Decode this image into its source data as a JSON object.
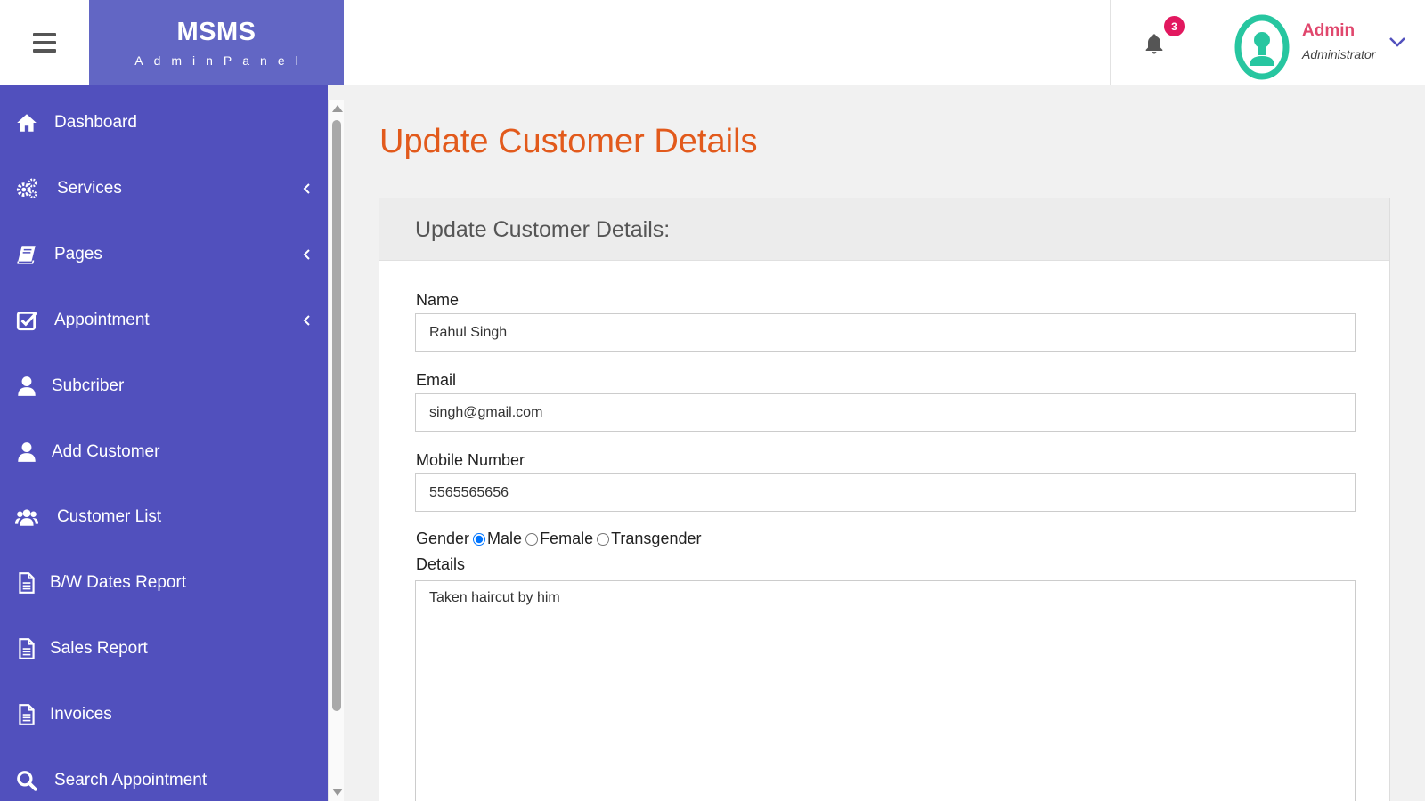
{
  "app": {
    "brand": "MSMS",
    "brand_sub": "AdminPanel"
  },
  "header": {
    "notification_count": "3",
    "user_name": "Admin",
    "user_role": "Administrator",
    "icons": {
      "menu": "hamburger-icon",
      "bell": "bell-icon",
      "avatar": "user-avatar-icon",
      "dropdown": "chevron-down-icon"
    }
  },
  "sidebar": {
    "items": [
      {
        "label": "Dashboard",
        "icon": "home-icon",
        "has_submenu": false
      },
      {
        "label": "Services",
        "icon": "gears-icon",
        "has_submenu": true
      },
      {
        "label": "Pages",
        "icon": "book-icon",
        "has_submenu": true
      },
      {
        "label": "Appointment",
        "icon": "check-square-icon",
        "has_submenu": true
      },
      {
        "label": "Subcriber",
        "icon": "user-icon",
        "has_submenu": false
      },
      {
        "label": "Add Customer",
        "icon": "user-icon",
        "has_submenu": false
      },
      {
        "label": "Customer List",
        "icon": "users-icon",
        "has_submenu": false
      },
      {
        "label": "B/W Dates Report",
        "icon": "file-icon",
        "has_submenu": false
      },
      {
        "label": "Sales Report",
        "icon": "file-icon",
        "has_submenu": false
      },
      {
        "label": "Invoices",
        "icon": "file-icon",
        "has_submenu": false
      },
      {
        "label": "Search Appointment",
        "icon": "search-icon",
        "has_submenu": false
      }
    ]
  },
  "main": {
    "page_title": "Update Customer Details",
    "panel_title": "Update Customer Details:",
    "form": {
      "name_label": "Name",
      "name_value": "Rahul Singh",
      "email_label": "Email",
      "email_value": "singh@gmail.com",
      "mobile_label": "Mobile Number",
      "mobile_value": "5565565656",
      "gender_label": "Gender",
      "gender_options": [
        "Male",
        "Female",
        "Transgender"
      ],
      "gender_selected": "Male",
      "details_label": "Details",
      "details_value": "Taken haircut by him"
    }
  },
  "colors": {
    "sidebar_bg": "#5150bd",
    "brand_bg": "#6266c4",
    "title_orange": "#e25a1c",
    "badge": "#e2185f",
    "user_name": "#e0476d",
    "avatar_ring": "#27c6a0"
  }
}
